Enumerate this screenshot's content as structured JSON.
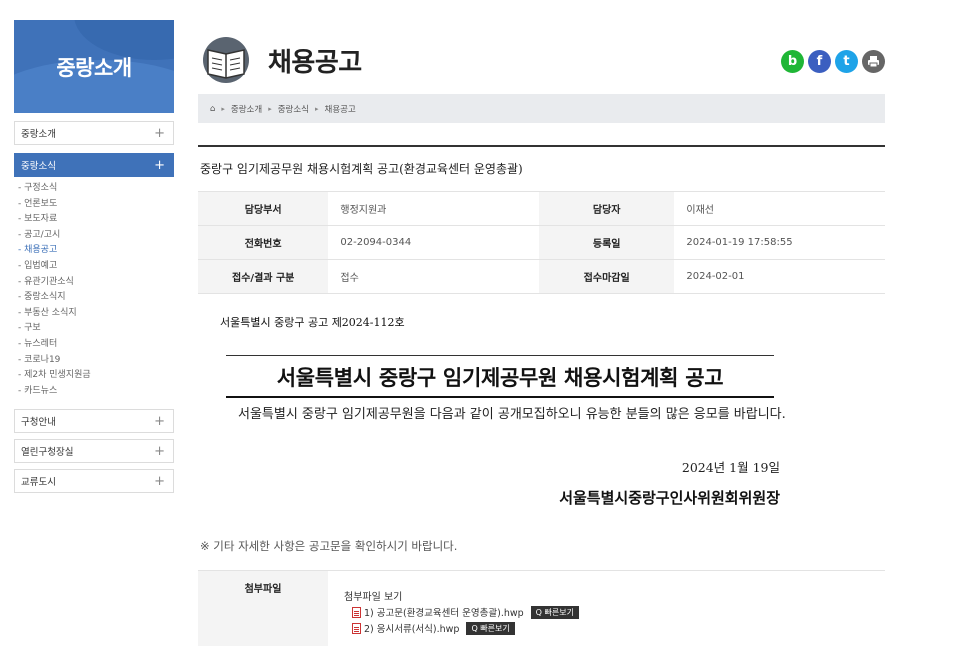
{
  "sidebar": {
    "banner_title": "중랑소개",
    "items_top": [
      {
        "label": "중랑소개"
      }
    ],
    "active_item": {
      "label": "중랑소식"
    },
    "sub_items": [
      {
        "label": "- 구정소식"
      },
      {
        "label": "- 언론보도"
      },
      {
        "label": "- 보도자료"
      },
      {
        "label": "- 공고/고시"
      },
      {
        "label": "- 채용공고"
      },
      {
        "label": "- 입법예고"
      },
      {
        "label": "- 유관기관소식"
      },
      {
        "label": "- 중랑소식지"
      },
      {
        "label": "- 부동산 소식지"
      },
      {
        "label": "- 구보"
      },
      {
        "label": "- 뉴스레터"
      },
      {
        "label": "- 코로나19"
      },
      {
        "label": "- 제2차 민생지원금"
      },
      {
        "label": "- 카드뉴스"
      }
    ],
    "items_bottom": [
      {
        "label": "구청안내"
      },
      {
        "label": "열린구청장실"
      },
      {
        "label": "교류도시"
      }
    ],
    "plus": "+"
  },
  "header": {
    "title": "채용공고",
    "icons": [
      "book-icon",
      "blog-icon",
      "facebook-icon",
      "twitter-icon",
      "print-icon"
    ],
    "social": {
      "b": "b",
      "f": "f",
      "t": "t"
    }
  },
  "breadcrumb": {
    "home_icon": "⌂",
    "sep": "▸",
    "items": [
      "중랑소개",
      "중랑소식",
      "채용공고"
    ]
  },
  "post": {
    "title": "중랑구 임기제공무원 채용시험계획 공고(환경교육센터 운영총괄)",
    "rows": [
      {
        "l1": "담당부서",
        "v1": "행정지원과",
        "l2": "담당자",
        "v2": "이재선"
      },
      {
        "l1": "전화번호",
        "v1": "02-2094-0344",
        "l2": "등록일",
        "v2": "2024-01-19 17:58:55"
      },
      {
        "l1": "접수/결과 구분",
        "v1": "접수",
        "l2": "접수마감일",
        "v2": "2024-02-01"
      }
    ]
  },
  "notice": {
    "number": "서울특별시 중랑구 공고 제2024-112호",
    "title": "서울특별시 중랑구 임기제공무원 채용시험계획 공고",
    "body": "서울특별시 중랑구 임기제공무원을 다음과 같이 공개모집하오니 유능한 분들의 많은 응모를 바랍니다.",
    "date": "2024년 1월 19일",
    "signature": "서울특별시중랑구인사위원회위원장"
  },
  "note": "※ 기타 자세한 사항은 공고문을 확인하시기 바랍니다.",
  "attachments": {
    "label": "첨부파일",
    "view_label": "첨부파일 보기",
    "quick_label": "Q 빠른보기",
    "files": [
      {
        "name": "1) 공고문(환경교육센터 운영총괄).hwp"
      },
      {
        "name": "2) 응시서류(서식).hwp"
      }
    ]
  }
}
